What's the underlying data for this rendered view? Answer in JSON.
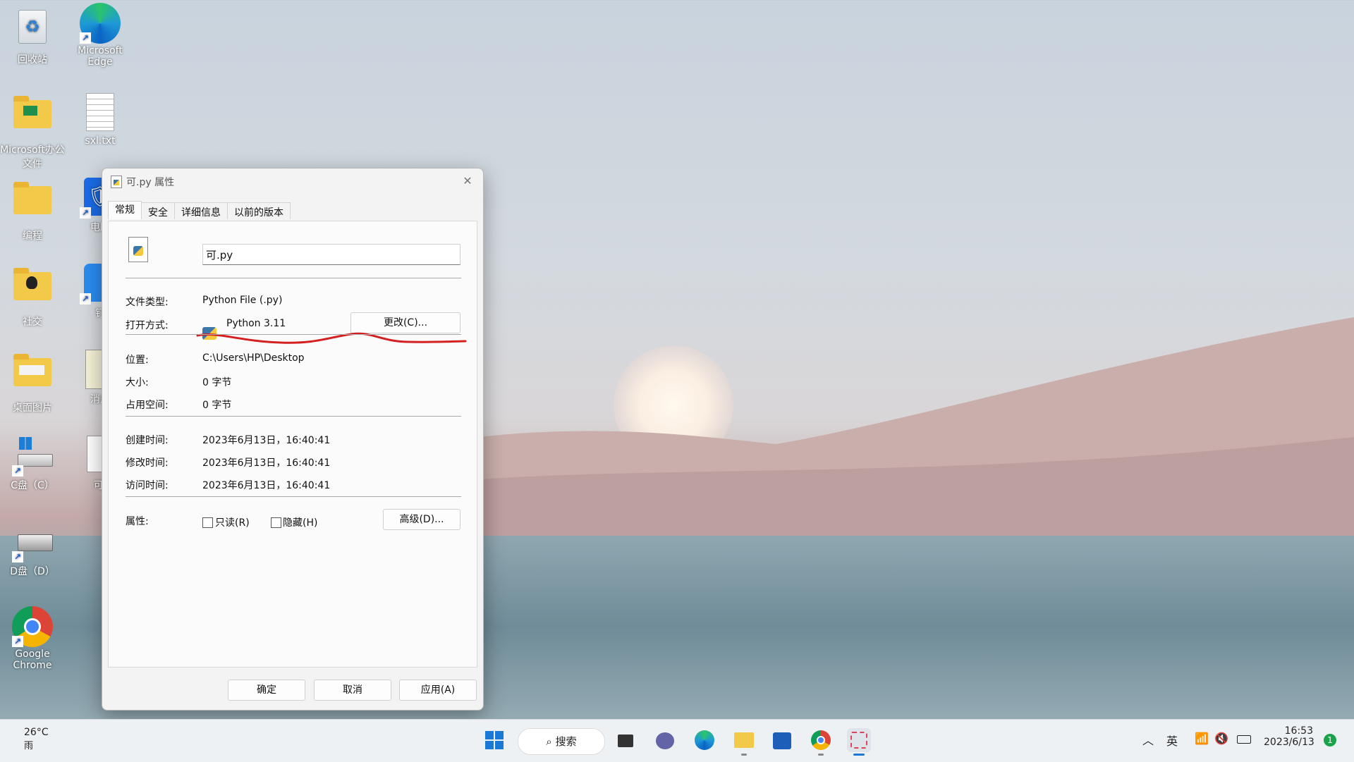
{
  "desktop": {
    "icons": [
      {
        "label": "回收站"
      },
      {
        "label": "Microsoft Edge"
      },
      {
        "label": "Microsoft办公文件"
      },
      {
        "label": "sxl.txt"
      },
      {
        "label": "编程"
      },
      {
        "label": "电脑"
      },
      {
        "label": "社交"
      },
      {
        "label": "钉"
      },
      {
        "label": "桌面图片"
      },
      {
        "label": "消息"
      },
      {
        "label": "C盘（C）"
      },
      {
        "label": "可."
      },
      {
        "label": "D盘（D）"
      },
      {
        "label": "Google Chrome"
      }
    ]
  },
  "dialog": {
    "title": "可.py 属性",
    "close_glyph": "✕",
    "tabs": [
      "常规",
      "安全",
      "详细信息",
      "以前的版本"
    ],
    "file_name": "可.py",
    "file_type_label": "文件类型:",
    "file_type_value": "Python File (.py)",
    "open_with_label": "打开方式:",
    "open_with_value": "Python 3.11",
    "change_button": "更改(C)...",
    "location_label": "位置:",
    "location_value": "C:\\Users\\HP\\Desktop",
    "size_label": "大小:",
    "size_value": "0 字节",
    "size_on_disk_label": "占用空间:",
    "size_on_disk_value": "0 字节",
    "created_label": "创建时间:",
    "created_value": "2023年6月13日，16:40:41",
    "modified_label": "修改时间:",
    "modified_value": "2023年6月13日，16:40:41",
    "accessed_label": "访问时间:",
    "accessed_value": "2023年6月13日，16:40:41",
    "attributes_label": "属性:",
    "readonly_label": "只读(R)",
    "hidden_label": "隐藏(H)",
    "advanced_button": "高级(D)...",
    "ok_button": "确定",
    "cancel_button": "取消",
    "apply_button": "应用(A)",
    "annotation_color": "#d42020"
  },
  "taskbar": {
    "weather_temp": "26°C",
    "weather_desc": "雨",
    "search_label": "搜索",
    "ime": "英",
    "time": "16:53",
    "date": "2023/6/13",
    "notification_count": "1"
  }
}
